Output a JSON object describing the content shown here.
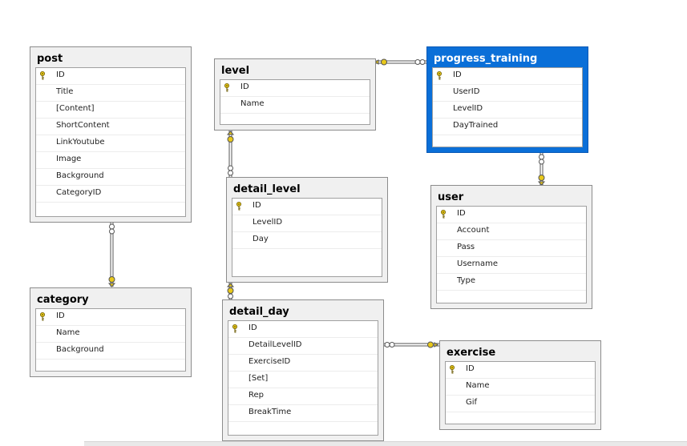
{
  "tables": {
    "post": {
      "name": "post",
      "columns": [
        "ID",
        "Title",
        "[Content]",
        "ShortContent",
        "LinkYoutube",
        "Image",
        "Background",
        "CategoryID"
      ]
    },
    "category": {
      "name": "category",
      "columns": [
        "ID",
        "Name",
        "Background"
      ]
    },
    "level": {
      "name": "level",
      "columns": [
        "ID",
        "Name"
      ]
    },
    "detail_level": {
      "name": "detail_level",
      "columns": [
        "ID",
        "LevelID",
        "Day"
      ]
    },
    "detail_day": {
      "name": "detail_day",
      "columns": [
        "ID",
        "DetailLevelID",
        "ExerciseID",
        "[Set]",
        "Rep",
        "BreakTime"
      ]
    },
    "progress_training": {
      "name": "progress_training",
      "columns": [
        "ID",
        "UserID",
        "LevelID",
        "DayTrained"
      ]
    },
    "user": {
      "name": "user",
      "columns": [
        "ID",
        "Account",
        "Pass",
        "Username",
        "Type"
      ]
    },
    "exercise": {
      "name": "exercise",
      "columns": [
        "ID",
        "Name",
        "Gif"
      ]
    }
  },
  "selected_table": "progress_training",
  "colors": {
    "selection": "#0a6fd8",
    "key": "#e8c81a",
    "connector": "#555555"
  }
}
